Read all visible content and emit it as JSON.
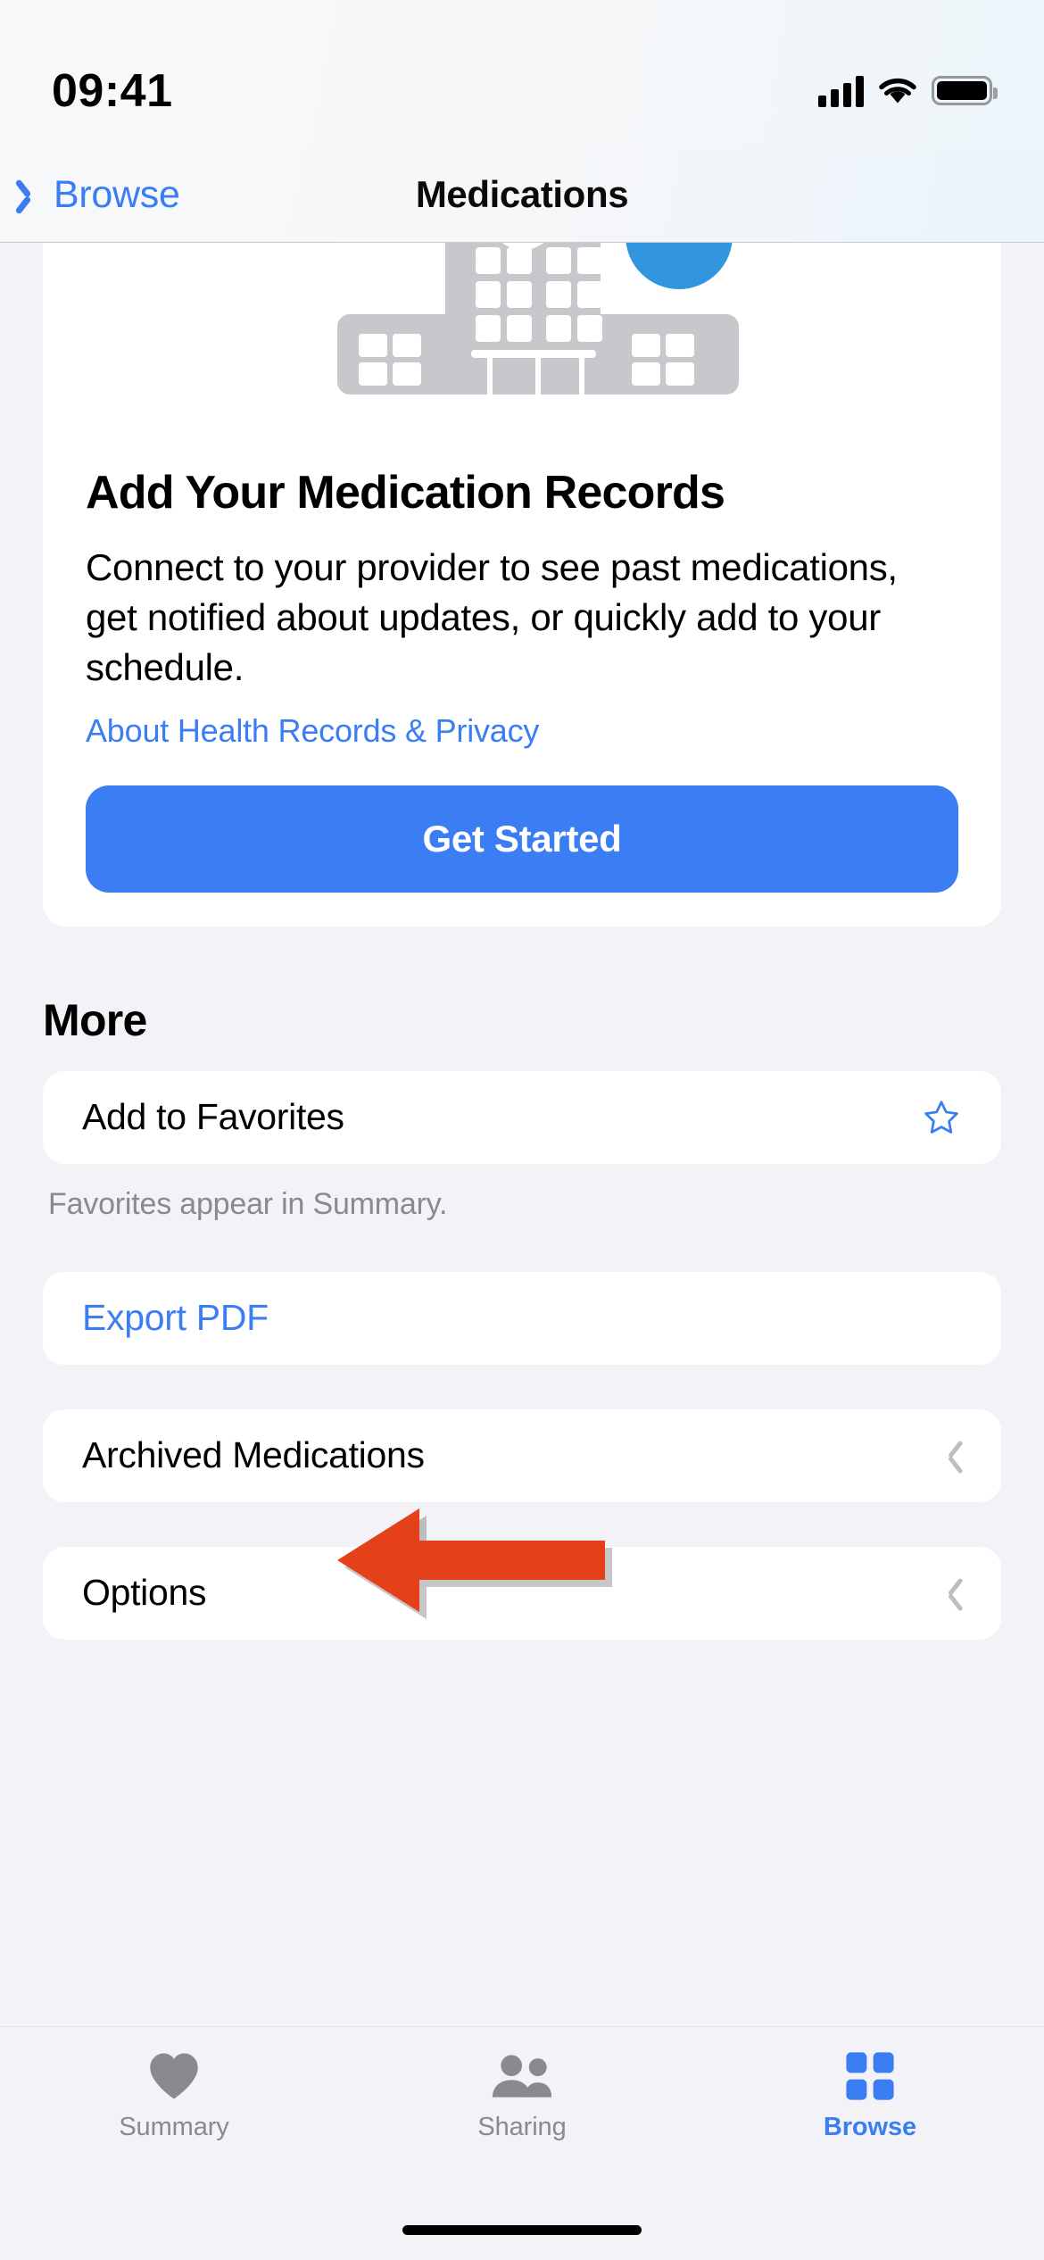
{
  "status_bar": {
    "time": "09:41",
    "cellular_icon": "cellular-bars-icon",
    "wifi_icon": "wifi-icon",
    "battery_icon": "battery-full-icon"
  },
  "nav": {
    "back_label": "Browse",
    "back_icon": "chevron-left-icon",
    "title": "Medications"
  },
  "hero": {
    "illustration_icon": "hospital-building-illustration",
    "title": "Add Your Medication Records",
    "body": "Connect to your provider to see past medications, get notified about updates, or quickly add to your schedule.",
    "link": "About Health Records & Privacy",
    "cta_label": "Get Started"
  },
  "more": {
    "section_title": "More",
    "rows": [
      {
        "label": "Add to Favorites",
        "accessory": "star-outline-icon",
        "style": "default"
      },
      {
        "label": "Export PDF",
        "accessory": "none",
        "style": "link"
      },
      {
        "label": "Archived Medications",
        "accessory": "chevron-right-icon",
        "style": "default"
      },
      {
        "label": "Options",
        "accessory": "chevron-right-icon",
        "style": "default"
      }
    ],
    "favorites_footnote": "Favorites appear in Summary."
  },
  "annotation": {
    "arrow_icon": "red-left-arrow-annotation",
    "points_at": "Export PDF"
  },
  "tabbar": {
    "tabs": [
      {
        "label": "Summary",
        "icon": "heart-icon",
        "active": false
      },
      {
        "label": "Sharing",
        "icon": "two-people-icon",
        "active": false
      },
      {
        "label": "Browse",
        "icon": "grid-squares-icon",
        "active": true
      }
    ]
  },
  "colors": {
    "accent_blue": "#3B7DF2",
    "annotation_red": "#E4411B",
    "group_background": "#F2F2F7",
    "illustration_gray": "#C7C7CC",
    "illustration_blue": "#3196DE",
    "secondary_text": "#8A8A8E"
  }
}
